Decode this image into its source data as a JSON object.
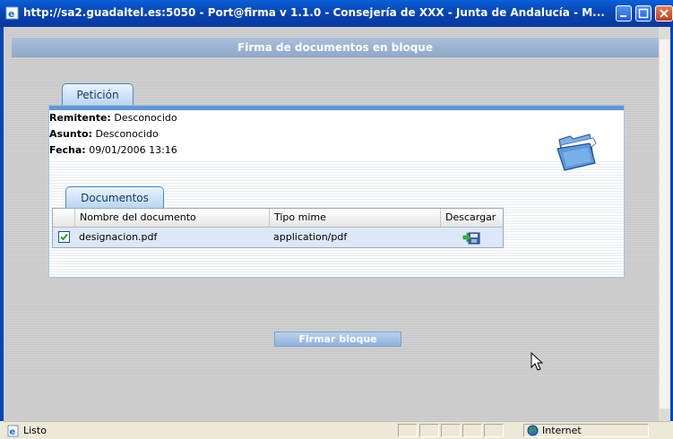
{
  "window": {
    "title": "http://sa2.guadaltel.es:5050 - Port@firma v 1.1.0 - Consejería de XXX - Junta de Andalucía - M..."
  },
  "page": {
    "header": "Firma de documentos en bloque"
  },
  "peticion": {
    "tab_label": "Petición",
    "remitente_label": "Remitente:",
    "remitente_value": "Desconocido",
    "asunto_label": "Asunto:",
    "asunto_value": "Desconocido",
    "fecha_label": "Fecha:",
    "fecha_value": "09/01/2006 13:16"
  },
  "documentos": {
    "tab_label": "Documentos",
    "columns": [
      "Nombre del documento",
      "Tipo mime",
      "Descargar"
    ],
    "rows": [
      {
        "checked": true,
        "name": "designacion.pdf",
        "mime": "application/pdf",
        "download_icon": "download-save-icon"
      }
    ]
  },
  "actions": {
    "firmar_label": "Firmar bloque"
  },
  "status": {
    "left": "Listo",
    "zone": "Internet"
  },
  "colors": {
    "titlebar": "#0846b4",
    "tab_border": "#4a88c8",
    "button": "#8cb2de"
  }
}
